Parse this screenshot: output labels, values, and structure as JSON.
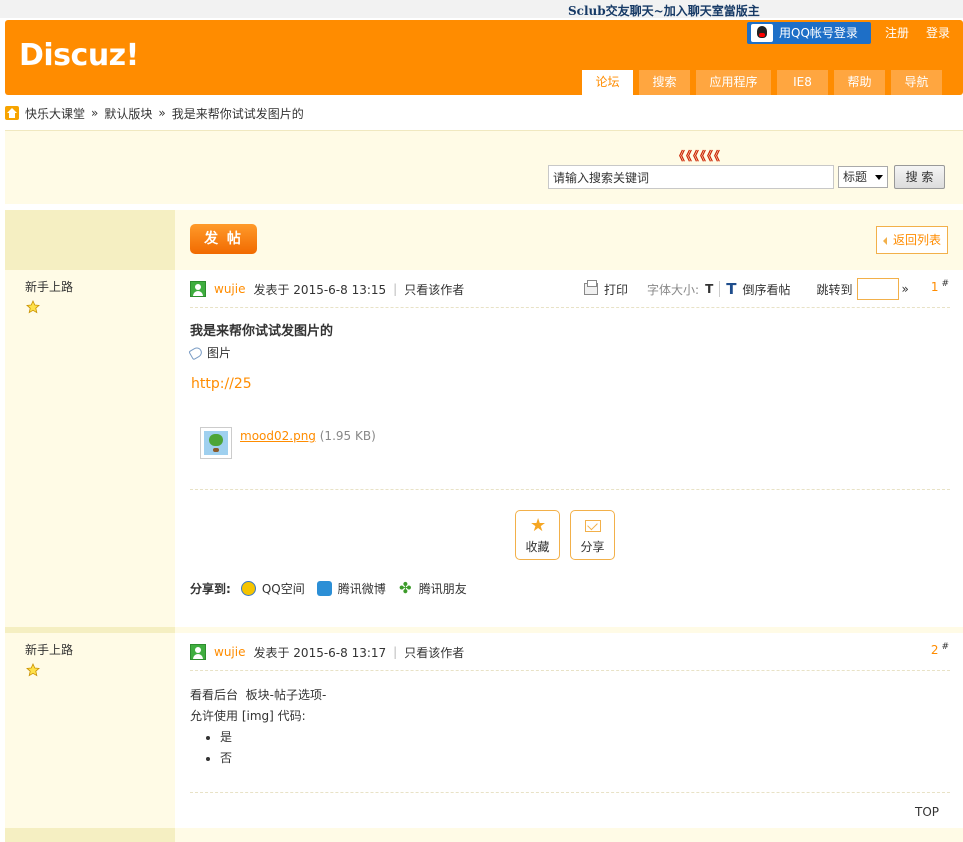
{
  "topbar": {
    "announcement": "Sclub交友聊天~加入聊天室當版主"
  },
  "header": {
    "logo": "Discuz!",
    "qq_login": "用QQ帐号登录",
    "register": "注册",
    "login": "登录",
    "tabs": [
      {
        "label": "论坛",
        "active": true
      },
      {
        "label": "搜索",
        "active": false
      },
      {
        "label": "应用程序",
        "active": false
      },
      {
        "label": "IE8",
        "active": false
      },
      {
        "label": "帮助",
        "active": false
      },
      {
        "label": "导航",
        "active": false
      }
    ]
  },
  "breadcrumb": {
    "home": "快乐大课堂",
    "board": "默认版块",
    "thread": "我是来帮你试试发图片的",
    "separator": "»"
  },
  "search": {
    "arrows": "《《《《《《",
    "placeholder": "请输入搜索关键词",
    "scope": "标题",
    "button": "搜 索"
  },
  "toolbar": {
    "post_button": "发 帖",
    "back_button": "返回列表"
  },
  "posts": [
    {
      "rank": "新手上路",
      "author": "wujie",
      "posted": "发表于 2015-6-8 13:15",
      "only_author": "只看该作者",
      "print": "打印",
      "font_size": "字体大小:",
      "font_t": "T",
      "font_T": "T",
      "reverse": "倒序看帖",
      "jump": "跳转到",
      "jump_arrow": "»",
      "floor": "1",
      "floor_mark": "#",
      "title": "我是来帮你试试发图片的",
      "tag": "图片",
      "link": "http://25",
      "attachment": {
        "name": "mood02.png",
        "size": "(1.95 KB)"
      },
      "favorite": "收藏",
      "share": "分享",
      "share_to": "分享到:",
      "share_targets": [
        "QQ空间",
        "腾讯微博",
        "腾讯朋友"
      ]
    },
    {
      "rank": "新手上路",
      "author": "wujie",
      "posted": "发表于 2015-6-8 13:17",
      "only_author": "只看该作者",
      "floor": "2",
      "floor_mark": "#",
      "line1": "看看后台  板块-帖子选项-",
      "line2": "允许使用 [img] 代码:",
      "options": [
        "是",
        "否"
      ],
      "top": "TOP"
    }
  ],
  "colors": {
    "brand_orange": "#ff8c00",
    "sidebar_bg": "#fffbe6"
  }
}
